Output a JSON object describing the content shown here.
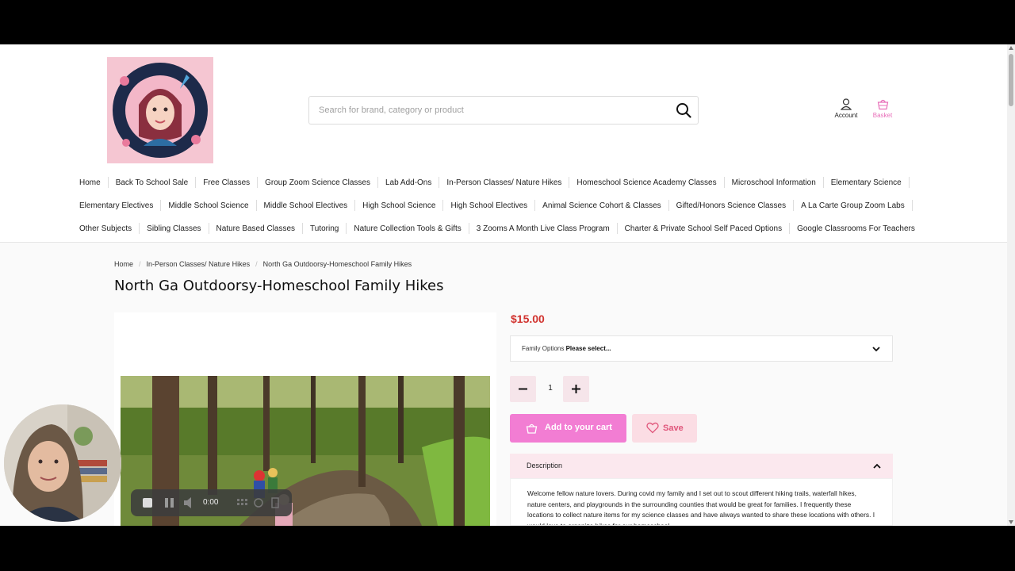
{
  "logo": {
    "alt": "Science With Mrs. Collins",
    "text": "SCIENCE WITH MRS. COLLINS"
  },
  "search": {
    "placeholder": "Search for brand, category or product"
  },
  "header": {
    "account_label": "Account",
    "basket_label": "Basket"
  },
  "nav": {
    "row1": [
      "Home",
      "Back To School Sale",
      "Free Classes",
      "Group Zoom Science Classes",
      "Lab Add-Ons",
      "In-Person Classes/ Nature Hikes",
      "Homeschool Science Academy Classes",
      "Microschool Information",
      "Elementary Science"
    ],
    "row2": [
      "Elementary Electives",
      "Middle School Science",
      "Middle School Electives",
      "High School Science",
      "High School Electives",
      "Animal Science Cohort & Classes",
      "Gifted/Honors Science Classes",
      "A La Carte Group Zoom Labs"
    ],
    "row3": [
      "Other Subjects",
      "Sibling Classes",
      "Nature Based Classes",
      "Tutoring",
      "Nature Collection Tools & Gifts",
      "3 Zooms A Month Live Class Program",
      "Charter & Private School Self Paced Options",
      "Google Classrooms For Teachers"
    ]
  },
  "breadcrumb": [
    "Home",
    "In-Person Classes/ Nature Hikes",
    "North Ga Outdoorsy-Homeschool Family Hikes"
  ],
  "product": {
    "title": "North Ga Outdoorsy-Homeschool Family Hikes",
    "price": "$15.00",
    "option_label": "Family Options",
    "option_value": "Please select...",
    "quantity": "1",
    "add_to_cart_label": "Add to your cart",
    "save_label": "Save",
    "description_label": "Description",
    "description_text": "Welcome fellow nature lovers. During covid my family and I set out to scout different hiking trails, waterfall hikes, nature centers, and playgrounds in the surrounding counties that would be great for families. I frequently these locations to collect nature items for my science classes and have always wanted to share these locations with others. I would love to organize hikes for our homeschool"
  },
  "recorder": {
    "time": "0:00"
  },
  "colors": {
    "accent_pink": "#f27dd3",
    "price_red": "#d1332f",
    "soft_pink": "#fbdde4"
  }
}
